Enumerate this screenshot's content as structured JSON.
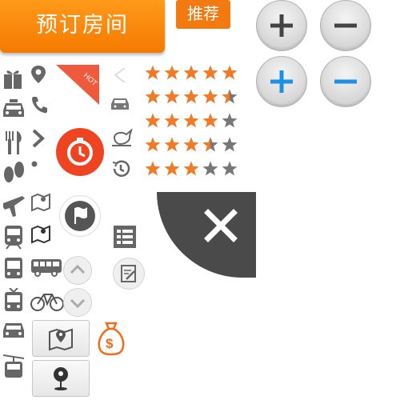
{
  "booking": {
    "book_label": "预订房间",
    "recommend_label": "推荐"
  },
  "hot_tag": {
    "label": "HOT"
  },
  "ratings": [
    {
      "stars": 5
    },
    {
      "stars": 4.5
    },
    {
      "stars": 4
    },
    {
      "stars": 3.5
    },
    {
      "stars": 3
    }
  ],
  "colors": {
    "accent": "#f47a00",
    "star_on": "#f07a26",
    "star_off": "#777777",
    "icon_gray": "#666666",
    "blue": "#1c8fe6",
    "red": "#ee4422",
    "dark": "#4a4a4a"
  }
}
